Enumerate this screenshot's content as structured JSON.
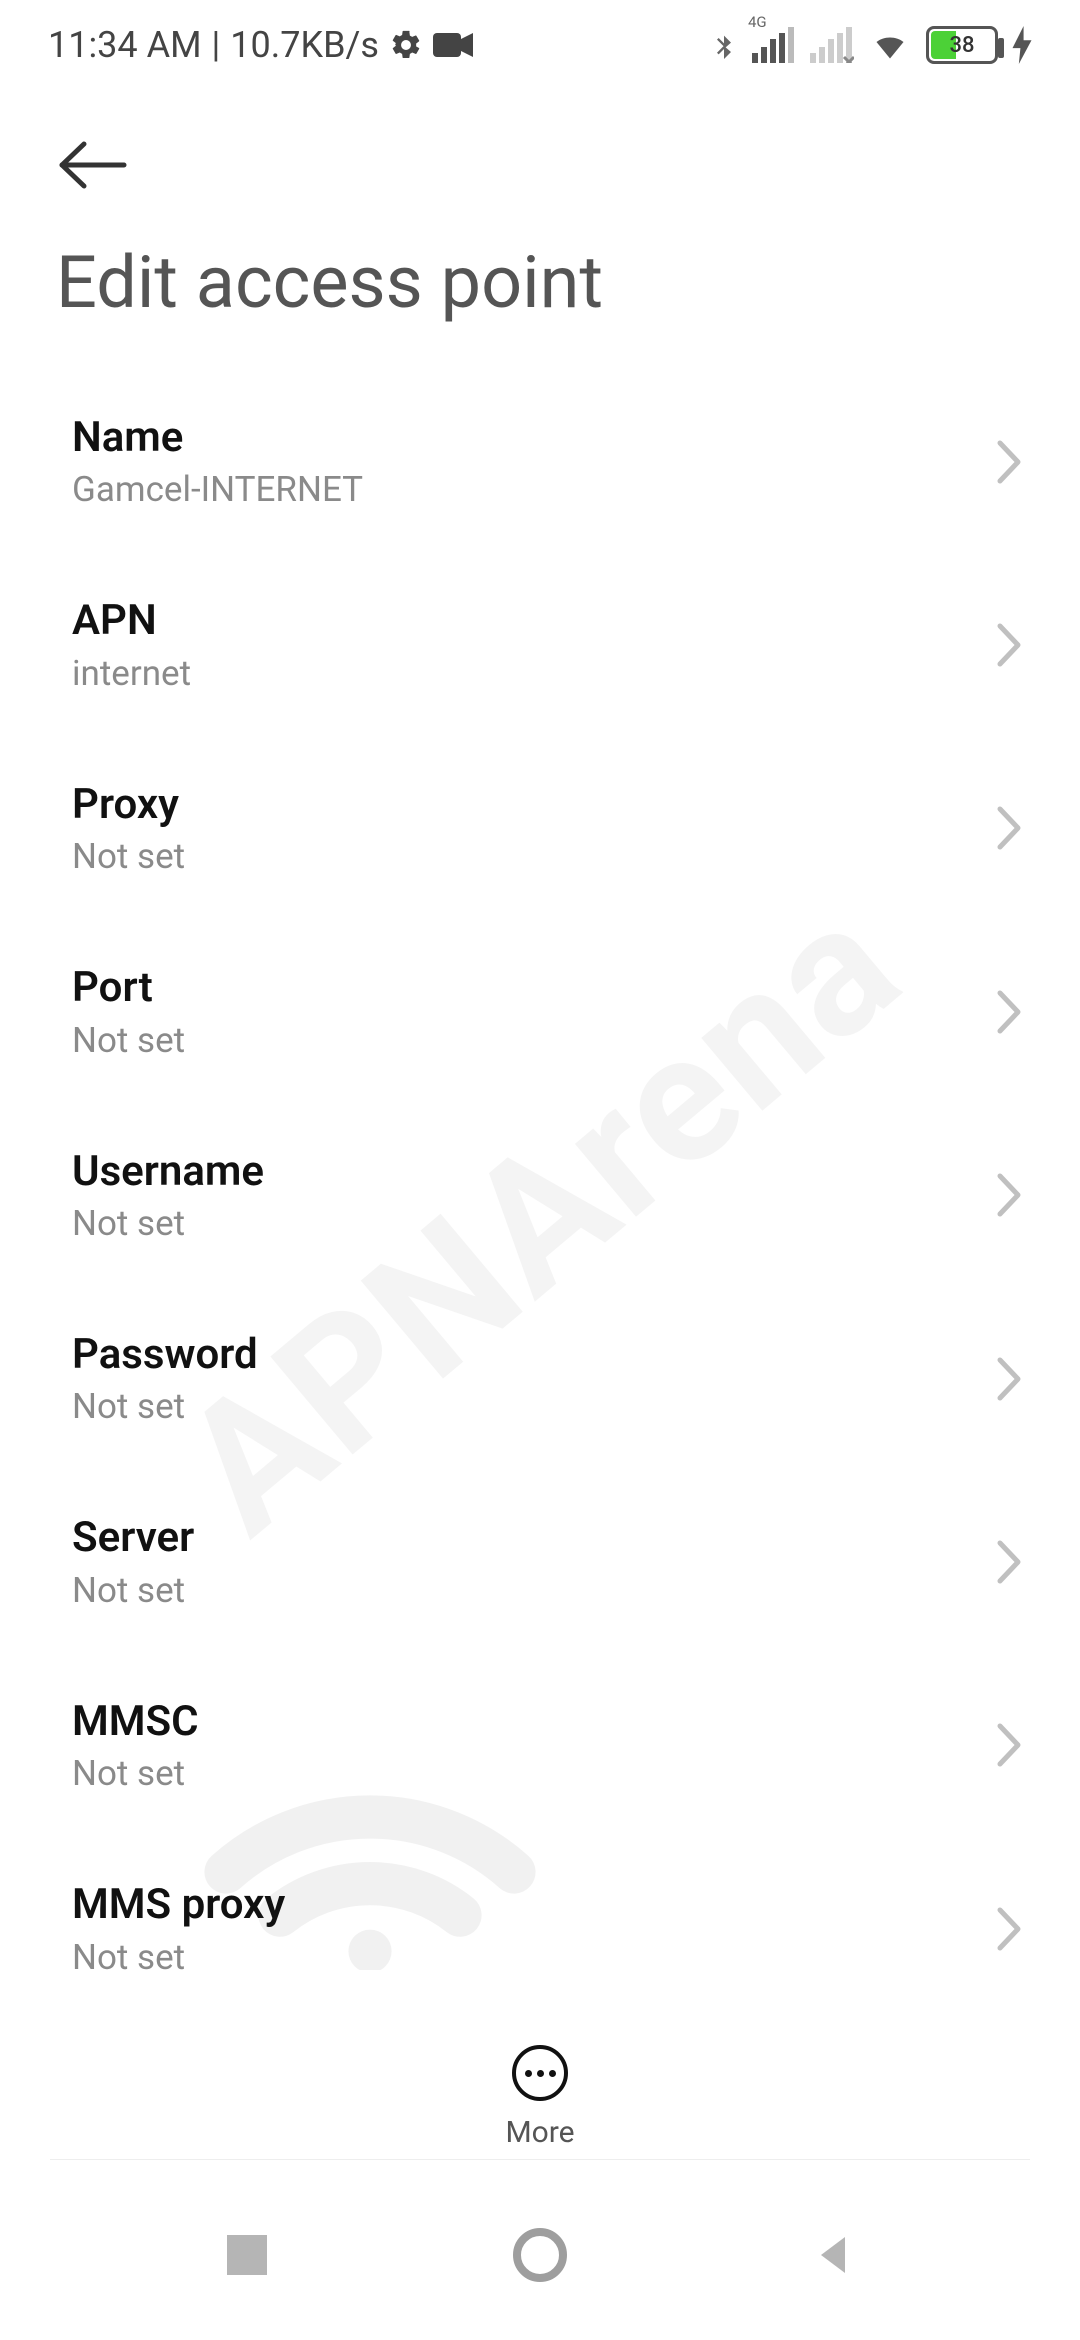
{
  "status": {
    "time": "11:34 AM",
    "sep": "|",
    "net_speed": "10.7KB/s",
    "signal1_superscript": "4G",
    "battery_pct": "38"
  },
  "header": {
    "title": "Edit access point"
  },
  "rows": [
    {
      "label": "Name",
      "value": "Gamcel-INTERNET"
    },
    {
      "label": "APN",
      "value": "internet"
    },
    {
      "label": "Proxy",
      "value": "Not set"
    },
    {
      "label": "Port",
      "value": "Not set"
    },
    {
      "label": "Username",
      "value": "Not set"
    },
    {
      "label": "Password",
      "value": "Not set"
    },
    {
      "label": "Server",
      "value": "Not set"
    },
    {
      "label": "MMSC",
      "value": "Not set"
    },
    {
      "label": "MMS proxy",
      "value": "Not set"
    }
  ],
  "bottom": {
    "more_label": "More"
  },
  "watermark": "APNArena"
}
